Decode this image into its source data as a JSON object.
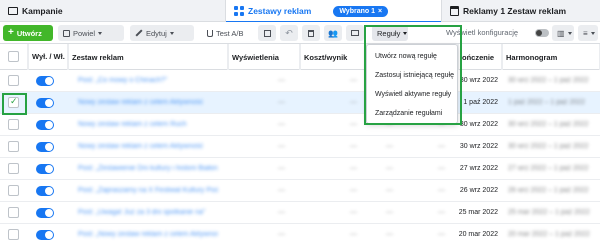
{
  "tabs": {
    "campaigns": "Kampanie",
    "adsets": "Zestawy reklam",
    "selected_badge": "Wybrano 1",
    "ads": "Reklamy 1 Zestaw reklam"
  },
  "toolbar": {
    "create": "Utwórz",
    "duplicate": "Powiel",
    "edit": "Edytuj",
    "ab_test": "Test A/B",
    "rules": "Reguły",
    "view_settings": "Wyświetl konfigurację"
  },
  "rules_menu": {
    "items": [
      "Utwórz nową regułę",
      "Zastosuj istniejącą regułę",
      "Wyświetl aktywne reguły",
      "Zarządzanie regułami"
    ]
  },
  "table": {
    "headers": {
      "onoff": "Wył. / Wł.",
      "name": "Zestaw reklam",
      "impressions": "Wyświetlenia",
      "cost": "Koszt/wynik",
      "start": "ończenie",
      "schedule": "Harmonogram"
    },
    "rows": [
      {
        "name": "Post: „Co mowy o Chinach?”",
        "start": "30 wrz 2022",
        "schedule": "30 wrz 2022 – 1 paź 2022",
        "selected": false,
        "impressions": "—",
        "cost": "—",
        "x1": "—",
        "x2": "—"
      },
      {
        "name": "Nowy zestaw reklam z celem Aktywność",
        "start": "1 paź 2022",
        "schedule": "1 paź 2022 – 1 paź 2022",
        "selected": true,
        "impressions": "—",
        "cost": "—",
        "x1": "—",
        "x2": "—"
      },
      {
        "name": "Nowy zestaw reklam z celem Ruch",
        "start": "30 wrz 2022",
        "schedule": "30 wrz 2022 – 1 paź 2022",
        "selected": false,
        "impressions": "—",
        "cost": "—",
        "x1": "—",
        "x2": "—"
      },
      {
        "name": "Nowy zestaw reklam z celem Aktywność",
        "start": "30 wrz 2022",
        "schedule": "30 wrz 2022 – 1 paź 2022",
        "selected": false,
        "impressions": "—",
        "cost": "—",
        "x1": "—",
        "x2": "—"
      },
      {
        "name": "Post: „Zestawienie Dni kultury i historii Białoru”",
        "start": "27 wrz 2022",
        "schedule": "27 wrz 2022 – 1 paź 2022",
        "selected": false,
        "impressions": "—",
        "cost": "—",
        "x1": "—",
        "x2": "—"
      },
      {
        "name": "Post: „Zapraszamy na X Festiwal Kultury Podróży”",
        "start": "26 wrz 2022",
        "schedule": "26 wrz 2022 – 1 paź 2022",
        "selected": false,
        "impressions": "—",
        "cost": "—",
        "x1": "—",
        "x2": "—"
      },
      {
        "name": "Post: „Uwaga! Już za 3 dni spotkanie na”",
        "start": "25 mar 2022",
        "schedule": "25 mar 2022 – 1 paź 2022",
        "selected": false,
        "impressions": "—",
        "cost": "—",
        "x1": "—",
        "x2": "—"
      },
      {
        "name": "Post: „Nowy zestaw reklam z celem Aktywność”",
        "start": "20 mar 2022",
        "schedule": "20 mar 2022 – 1 paź 2022",
        "selected": false,
        "impressions": "—",
        "cost": "—",
        "x1": "—",
        "x2": "—"
      }
    ]
  },
  "colors": {
    "primary": "#1877f2",
    "create": "#42b72a",
    "highlight": "#27a243"
  }
}
